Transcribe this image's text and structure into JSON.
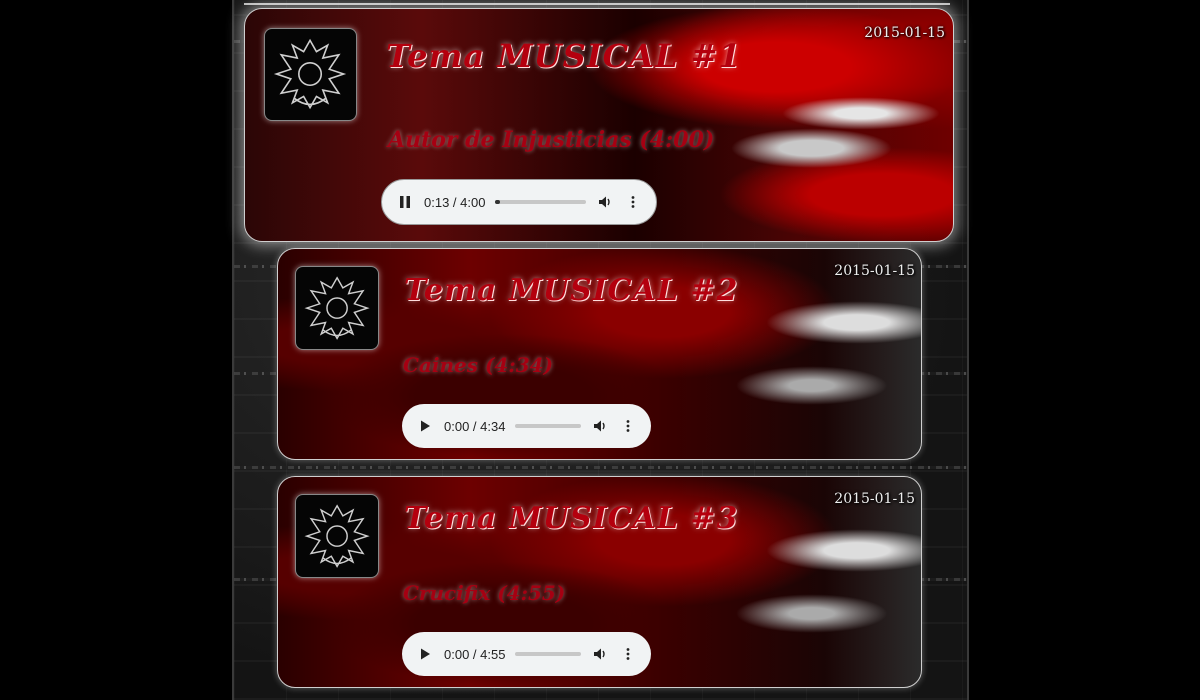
{
  "tracks": [
    {
      "date": "2015-01-15",
      "title": "Tema MUSICAL #1",
      "subtitle": "Autor de Injusticias (4:00)",
      "player": {
        "state": "playing",
        "time": "0:13 / 4:00",
        "progress": 0.054
      }
    },
    {
      "date": "2015-01-15",
      "title": "Tema MUSICAL #2",
      "subtitle": "Caines (4:34)",
      "player": {
        "state": "paused",
        "time": "0:00 / 4:34",
        "progress": 0
      }
    },
    {
      "date": "2015-01-15",
      "title": "Tema MUSICAL #3",
      "subtitle": "Crucifix (4:55)",
      "player": {
        "state": "paused",
        "time": "0:00 / 4:55",
        "progress": 0
      }
    }
  ],
  "icons": {
    "pause": "pause-icon",
    "play": "play-icon",
    "volume": "volume-icon",
    "more": "more-vertical-icon",
    "logo": "band-logo"
  },
  "colors": {
    "accent": "#b4000e",
    "player_bg": "#f1f3f4"
  }
}
